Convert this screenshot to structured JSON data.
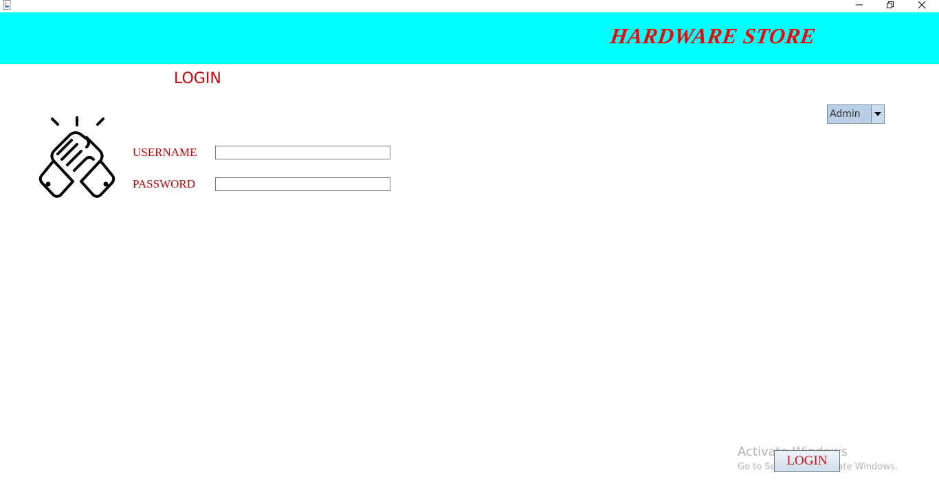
{
  "window": {
    "app_icon": "java-cup-icon",
    "controls": [
      "minimize-icon",
      "restore-icon",
      "close-icon"
    ]
  },
  "banner": {
    "title": "HARDWARE STORE",
    "background": "#00ffff",
    "title_color": "#ff0000"
  },
  "heading": {
    "title": "LOGIN"
  },
  "form": {
    "logo_icon": "handshake-icon",
    "username_label": "USERNAME",
    "username_value": "",
    "password_label": "PASSWORD",
    "password_value": "",
    "label_color": "#cc0000"
  },
  "role": {
    "selected": "Admin"
  },
  "actions": {
    "login_label": "LOGIN"
  },
  "watermark": {
    "line1": "Activate Windows",
    "line2": "Go to Settings to activate Windows."
  }
}
